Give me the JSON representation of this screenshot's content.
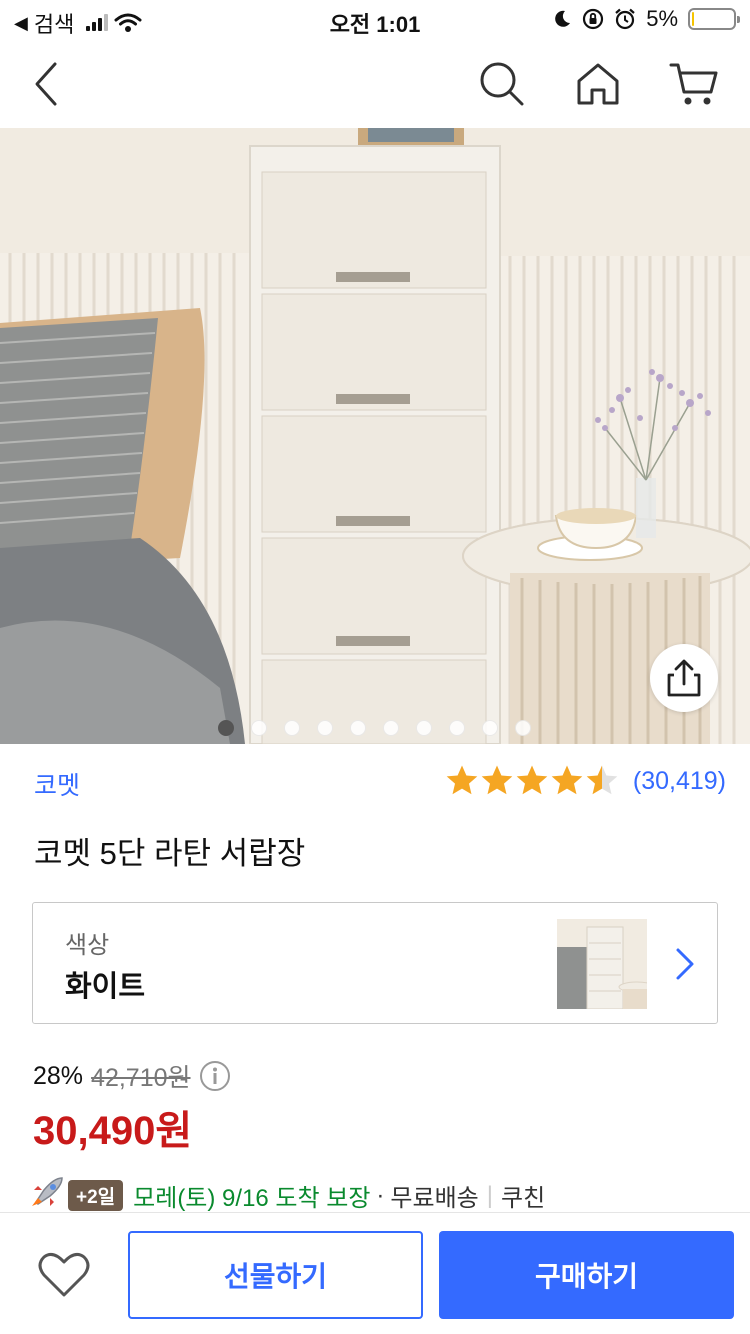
{
  "status_bar": {
    "back_app": "검색",
    "time": "오전 1:01",
    "battery": "5%",
    "battery_level": 0.05
  },
  "product": {
    "brand": "코멧",
    "rating": 4.5,
    "review_count": "(30,419)",
    "title": "코멧 5단 라탄 서랍장"
  },
  "option": {
    "label": "색상",
    "value": "화이트"
  },
  "price": {
    "discount": "28%",
    "original": "42,710원",
    "final": "30,490원"
  },
  "delivery": {
    "badge": "+2일",
    "eta": "모레(토) 9/16 도착 보장",
    "separator_dot": "·",
    "shipping": "무료배송",
    "separator_bar": "|",
    "carrier": "쿠친"
  },
  "gallery": {
    "total": 10,
    "active_index": 0
  },
  "actions": {
    "gift_label": "선물하기",
    "buy_label": "구매하기"
  },
  "colors": {
    "accent": "#346aff",
    "price": "#c81a1a",
    "delivery": "#0a8a2e",
    "star": "#f5a623"
  }
}
